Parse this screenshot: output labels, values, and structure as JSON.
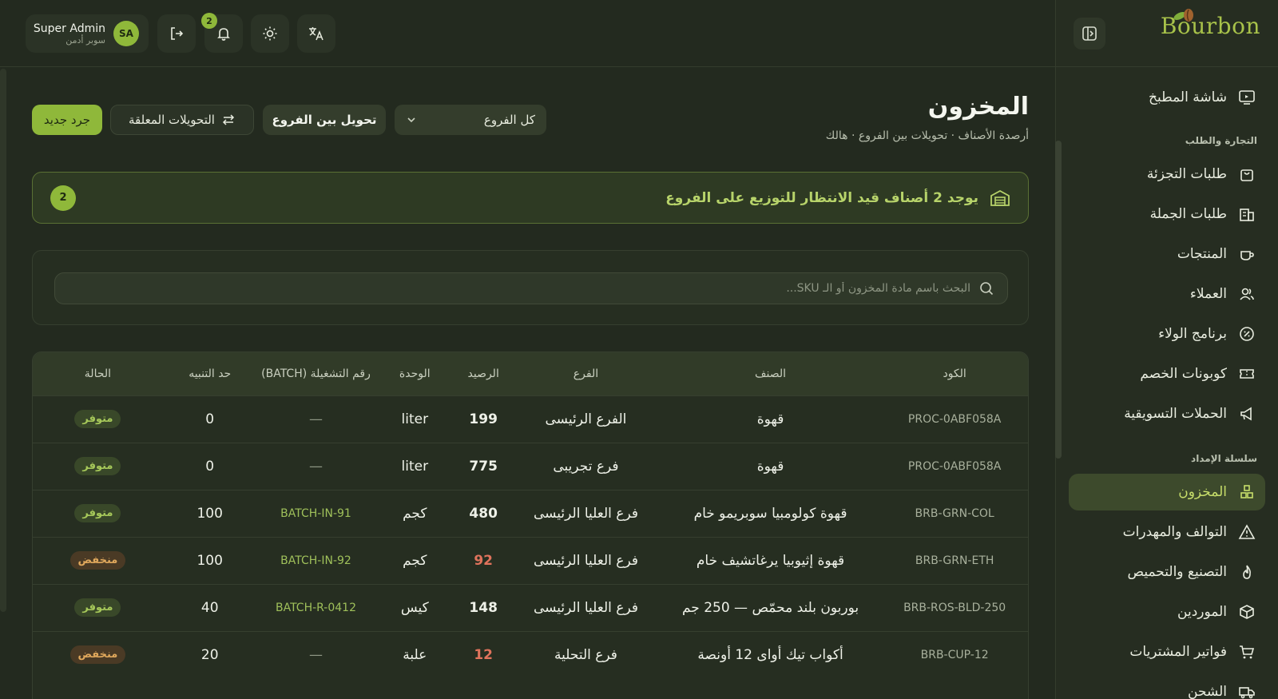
{
  "brand": {
    "logo_text": "Bourbon"
  },
  "user": {
    "name": "Super Admin",
    "role": "سوبر أدمن",
    "initials": "SA"
  },
  "notifications": {
    "count": "2"
  },
  "sidebar": {
    "items_top": [
      {
        "label": "شاشة المطبخ",
        "icon": "monitor-icon"
      }
    ],
    "section_commerce": "التجارة والطلب",
    "commerce_items": [
      {
        "label": "طلبات التجزئة",
        "icon": "shopping-bag-icon"
      },
      {
        "label": "طلبات الجملة",
        "icon": "building-icon"
      },
      {
        "label": "المنتجات",
        "icon": "coffee-cup-icon"
      },
      {
        "label": "العملاء",
        "icon": "users-icon"
      },
      {
        "label": "برنامج الولاء",
        "icon": "badge-percent-icon"
      },
      {
        "label": "كوبونات الخصم",
        "icon": "ticket-icon"
      },
      {
        "label": "الحملات التسويقية",
        "icon": "megaphone-icon"
      }
    ],
    "section_supply": "سلسلة الإمداد",
    "supply_items": [
      {
        "label": "المخزون",
        "icon": "boxes-icon",
        "active": true
      },
      {
        "label": "التوالف والمهدرات",
        "icon": "warning-icon"
      },
      {
        "label": "التصنيع والتحميص",
        "icon": "flame-icon"
      },
      {
        "label": "الموردين",
        "icon": "package-icon"
      },
      {
        "label": "فواتير المشتريات",
        "icon": "cart-icon"
      },
      {
        "label": "الشحن",
        "icon": "truck-icon"
      }
    ]
  },
  "page": {
    "title": "المخزون",
    "subtitle": "أرصدة الأصناف · تحويلات بين الفروع · هالك"
  },
  "actions": {
    "new_count": "جرد جديد",
    "pending_transfers": "التحويلات المعلقة",
    "transfer_between_branches": "تحويل بين الفروع",
    "branch_filter": "كل الفروع"
  },
  "alert": {
    "text": "يوجد 2 أصناف قيد الانتظار للتوزيع على الفروع",
    "count": "2"
  },
  "search": {
    "placeholder": "البحث باسم مادة المخزون أو الـ SKU..."
  },
  "table": {
    "headers": [
      "الكود",
      "الصنف",
      "الفرع",
      "الرصيد",
      "الوحدة",
      "رقم التشغيلة (BATCH)",
      "حد التنبيه",
      "الحالة"
    ],
    "rows": [
      {
        "code": "PROC-0ABF058A",
        "item": "قهوة",
        "branch": "الفرع الرئيسى",
        "qty": "199",
        "unit": "liter",
        "batch": "—",
        "alert_limit": "0",
        "status": "متوفر",
        "status_type": "ok"
      },
      {
        "code": "PROC-0ABF058A",
        "item": "قهوة",
        "branch": "فرع تجريبى",
        "qty": "775",
        "unit": "liter",
        "batch": "—",
        "alert_limit": "0",
        "status": "متوفر",
        "status_type": "ok"
      },
      {
        "code": "BRB-GRN-COL",
        "item": "قهوة كولومبيا سوبريمو خام",
        "branch": "فرع العليا الرئيسى",
        "qty": "480",
        "unit": "كجم",
        "batch": "BATCH-IN-91",
        "alert_limit": "100",
        "status": "متوفر",
        "status_type": "ok"
      },
      {
        "code": "BRB-GRN-ETH",
        "item": "قهوة إثيوبيا يرغاتشيف خام",
        "branch": "فرع العليا الرئيسى",
        "qty": "92",
        "unit": "كجم",
        "batch": "BATCH-IN-92",
        "alert_limit": "100",
        "status": "منخفض",
        "status_type": "low"
      },
      {
        "code": "BRB-ROS-BLD-250",
        "item": "بوربون بلند محمّص — 250 جم",
        "branch": "فرع العليا الرئيسى",
        "qty": "148",
        "unit": "كيس",
        "batch": "BATCH-R-0412",
        "alert_limit": "40",
        "status": "متوفر",
        "status_type": "ok"
      },
      {
        "code": "BRB-CUP-12",
        "item": "أكواب تيك أواى 12 أونصة",
        "branch": "فرع التحلية",
        "qty": "12",
        "unit": "علبة",
        "batch": "—",
        "alert_limit": "20",
        "status": "منخفض",
        "status_type": "low"
      }
    ]
  },
  "colors": {
    "accent": "#8fb83a",
    "low": "#e0735c",
    "background": "#232a1f"
  }
}
